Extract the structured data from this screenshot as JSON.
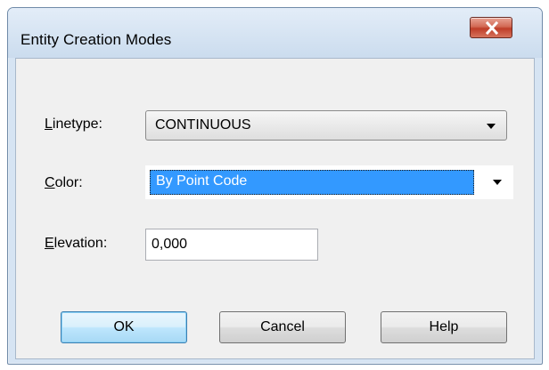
{
  "window": {
    "title": "Entity Creation Modes"
  },
  "linetype": {
    "label_u": "L",
    "label_rest": "inetype:",
    "value": "CONTINUOUS"
  },
  "color": {
    "label_u": "C",
    "label_rest": "olor:",
    "value": "By Point Code"
  },
  "elevation": {
    "label_u": "E",
    "label_rest": "levation:",
    "value": "0,000"
  },
  "buttons": {
    "ok": "OK",
    "cancel": "Cancel",
    "help": "Help"
  },
  "icons": {
    "close": "close-icon",
    "dropdown": "chevron-down-icon"
  },
  "colors": {
    "selection": "#3399ff",
    "close_button": "#c9503b",
    "default_button_border": "#3c7fb1"
  }
}
